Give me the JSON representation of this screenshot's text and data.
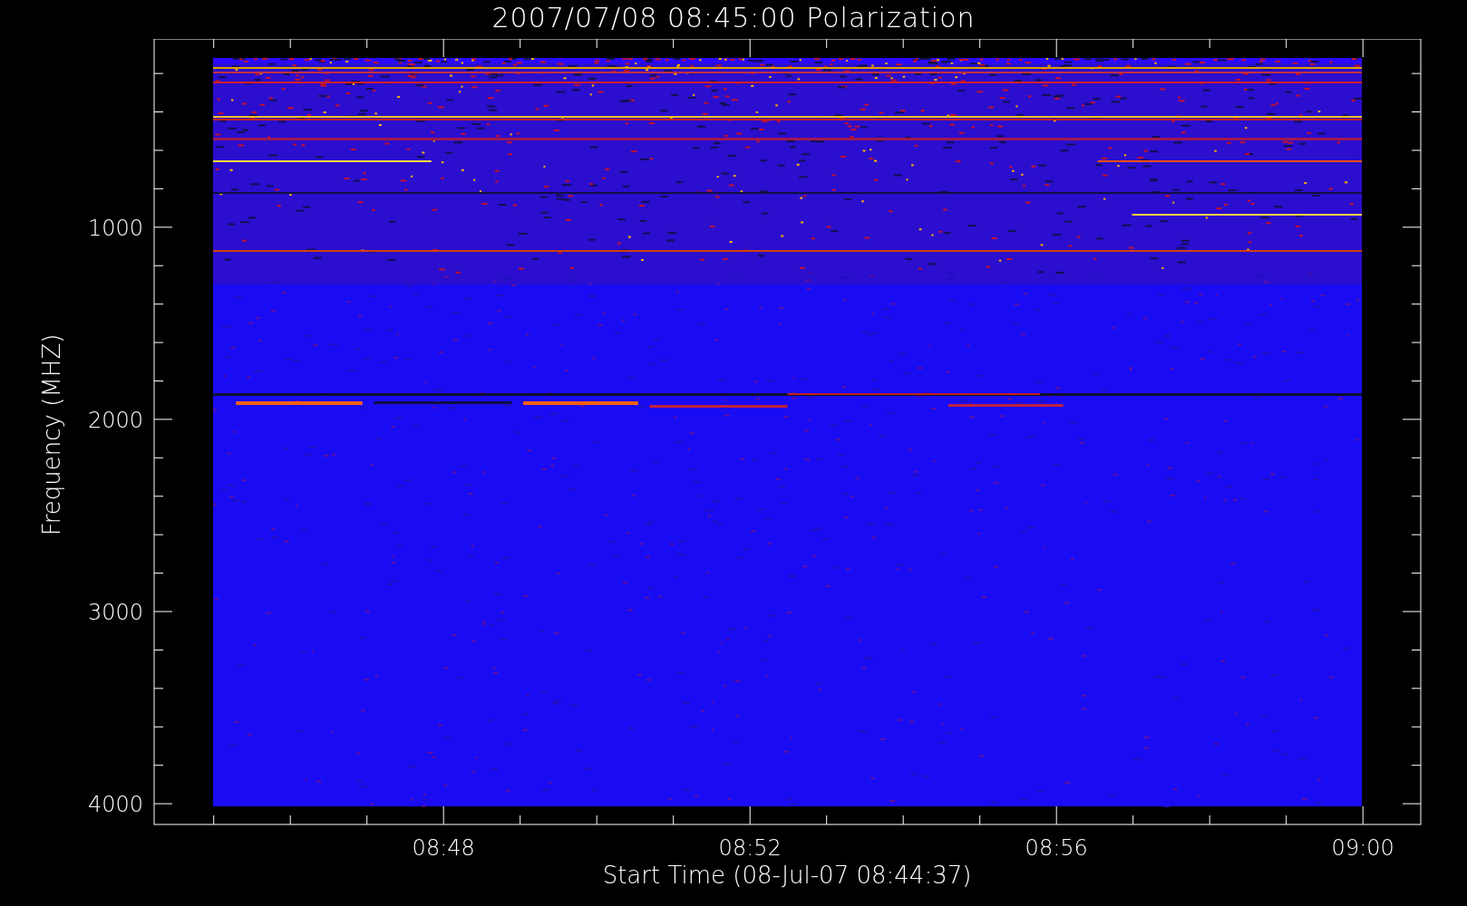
{
  "title": "2007/07/08 08:45:00 Polarization",
  "plot": {
    "ylabel": "Frequency (MHZ)",
    "xlabel": "Start Time (08-Jul-07 08:44:37)",
    "yticks": [
      "1000",
      "2000",
      "3000",
      "4000"
    ],
    "xticks": [
      "08:48",
      "08:52",
      "08:56",
      "09:00"
    ]
  }
}
